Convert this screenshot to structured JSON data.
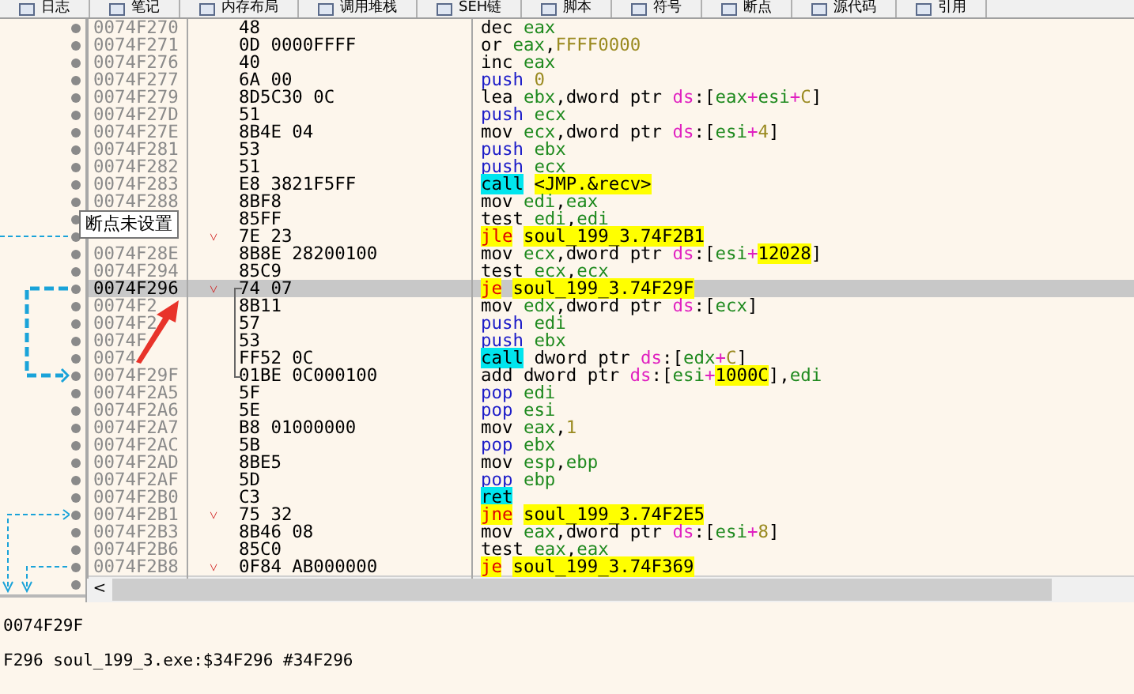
{
  "tabs": [
    {
      "label": "日志",
      "selected": false
    },
    {
      "label": "笔记",
      "selected": false
    },
    {
      "label": "内存布局",
      "selected": false
    },
    {
      "label": "调用堆栈",
      "selected": false
    },
    {
      "label": "SEH链",
      "selected": false
    },
    {
      "label": "脚本",
      "selected": false
    },
    {
      "label": "符号",
      "selected": false
    },
    {
      "label": "断点",
      "selected": false
    },
    {
      "label": "源代码",
      "selected": false
    },
    {
      "label": "引用",
      "selected": false
    }
  ],
  "rows": [
    {
      "address": "0074F270",
      "bytes": "48",
      "selected": false,
      "asm": [
        {
          "kind": "op",
          "text": "dec "
        },
        {
          "kind": "reg",
          "text": "eax"
        }
      ]
    },
    {
      "address": "0074F271",
      "bytes": "0D 0000FFFF",
      "selected": false,
      "asm": [
        {
          "kind": "op",
          "text": "or "
        },
        {
          "kind": "reg",
          "text": "eax"
        },
        {
          "kind": "txt",
          "text": ","
        },
        {
          "kind": "num",
          "text": "FFFF0000"
        }
      ]
    },
    {
      "address": "0074F276",
      "bytes": "40",
      "selected": false,
      "asm": [
        {
          "kind": "op",
          "text": "inc "
        },
        {
          "kind": "reg",
          "text": "eax"
        }
      ]
    },
    {
      "address": "0074F277",
      "bytes": "6A 00",
      "selected": false,
      "asm": [
        {
          "kind": "stack",
          "text": "push "
        },
        {
          "kind": "num",
          "text": "0"
        }
      ]
    },
    {
      "address": "0074F279",
      "bytes": "8D5C30 0C",
      "selected": false,
      "asm": [
        {
          "kind": "op",
          "text": "lea "
        },
        {
          "kind": "reg",
          "text": "ebx"
        },
        {
          "kind": "txt",
          "text": ",dword ptr "
        },
        {
          "kind": "seg",
          "text": "ds"
        },
        {
          "kind": "txt",
          "text": ":["
        },
        {
          "kind": "reg",
          "text": "eax"
        },
        {
          "kind": "seg",
          "text": "+"
        },
        {
          "kind": "reg",
          "text": "esi"
        },
        {
          "kind": "seg",
          "text": "+"
        },
        {
          "kind": "num",
          "text": "C"
        },
        {
          "kind": "txt",
          "text": "]"
        }
      ]
    },
    {
      "address": "0074F27D",
      "bytes": "51",
      "selected": false,
      "asm": [
        {
          "kind": "stack",
          "text": "push "
        },
        {
          "kind": "reg",
          "text": "ecx"
        }
      ]
    },
    {
      "address": "0074F27E",
      "bytes": "8B4E 04",
      "selected": false,
      "asm": [
        {
          "kind": "op",
          "text": "mov "
        },
        {
          "kind": "reg",
          "text": "ecx"
        },
        {
          "kind": "txt",
          "text": ",dword ptr "
        },
        {
          "kind": "seg",
          "text": "ds"
        },
        {
          "kind": "txt",
          "text": ":["
        },
        {
          "kind": "reg",
          "text": "esi"
        },
        {
          "kind": "seg",
          "text": "+"
        },
        {
          "kind": "num",
          "text": "4"
        },
        {
          "kind": "txt",
          "text": "]"
        }
      ]
    },
    {
      "address": "0074F281",
      "bytes": "53",
      "selected": false,
      "asm": [
        {
          "kind": "stack",
          "text": "push "
        },
        {
          "kind": "reg",
          "text": "ebx"
        }
      ]
    },
    {
      "address": "0074F282",
      "bytes": "51",
      "selected": false,
      "asm": [
        {
          "kind": "stack",
          "text": "push "
        },
        {
          "kind": "reg",
          "text": "ecx"
        }
      ]
    },
    {
      "address": "0074F283",
      "bytes": "E8 3821F5FF",
      "selected": false,
      "asm": [
        {
          "kind": "call",
          "text": "call"
        },
        {
          "kind": "label",
          "text": "<JMP.&recv>"
        }
      ]
    },
    {
      "address": "0074F288",
      "bytes": "8BF8",
      "selected": false,
      "asm": [
        {
          "kind": "op",
          "text": "mov "
        },
        {
          "kind": "reg",
          "text": "edi"
        },
        {
          "kind": "txt",
          "text": ","
        },
        {
          "kind": "reg",
          "text": "eax"
        }
      ]
    },
    {
      "bytes": "85FF",
      "selected": false,
      "asm": [
        {
          "kind": "op",
          "text": "test "
        },
        {
          "kind": "reg",
          "text": "edi"
        },
        {
          "kind": "txt",
          "text": ","
        },
        {
          "kind": "reg",
          "text": "edi"
        }
      ]
    },
    {
      "marker": "˅",
      "bytes": "7E 23",
      "selected": false,
      "asm": [
        {
          "kind": "jump",
          "text": "jle"
        },
        {
          "kind": "label",
          "text": "soul_199_3.74F2B1"
        }
      ]
    },
    {
      "address": "0074F28E",
      "bytes": "8B8E 28200100",
      "selected": false,
      "asm": [
        {
          "kind": "op",
          "text": "mov "
        },
        {
          "kind": "reg",
          "text": "ecx"
        },
        {
          "kind": "txt",
          "text": ",dword ptr "
        },
        {
          "kind": "seg",
          "text": "ds"
        },
        {
          "kind": "txt",
          "text": ":["
        },
        {
          "kind": "reg",
          "text": "esi"
        },
        {
          "kind": "seg",
          "text": "+"
        },
        {
          "kind": "hinum",
          "text": "12028"
        },
        {
          "kind": "txt",
          "text": "]"
        }
      ]
    },
    {
      "address": "0074F294",
      "bytes": "85C9",
      "selected": false,
      "asm": [
        {
          "kind": "op",
          "text": "test "
        },
        {
          "kind": "reg",
          "text": "ecx"
        },
        {
          "kind": "txt",
          "text": ","
        },
        {
          "kind": "reg",
          "text": "ecx"
        }
      ]
    },
    {
      "address": "0074F296",
      "marker": "˅",
      "bytes": "74 07",
      "selected": true,
      "asm": [
        {
          "kind": "jump",
          "text": "je"
        },
        {
          "kind": "label",
          "text": "soul_199_3.74F29F"
        }
      ]
    },
    {
      "address": "0074F2",
      "bytes": "8B11",
      "selected": false,
      "asm": [
        {
          "kind": "op",
          "text": "mov "
        },
        {
          "kind": "reg",
          "text": "edx"
        },
        {
          "kind": "txt",
          "text": ",dword ptr "
        },
        {
          "kind": "seg",
          "text": "ds"
        },
        {
          "kind": "txt",
          "text": ":["
        },
        {
          "kind": "reg",
          "text": "ecx"
        },
        {
          "kind": "txt",
          "text": "]"
        }
      ]
    },
    {
      "address": "0074F2",
      "bytes": "57",
      "selected": false,
      "asm": [
        {
          "kind": "stack",
          "text": "push "
        },
        {
          "kind": "reg",
          "text": "edi"
        }
      ]
    },
    {
      "address": "0074F",
      "bytes": "53",
      "selected": false,
      "asm": [
        {
          "kind": "stack",
          "text": "push "
        },
        {
          "kind": "reg",
          "text": "ebx"
        }
      ]
    },
    {
      "address": "0074",
      "bytes": "FF52 0C",
      "selected": false,
      "asm": [
        {
          "kind": "call",
          "text": "call"
        },
        {
          "kind": "txt",
          "text": " dword ptr "
        },
        {
          "kind": "seg",
          "text": "ds"
        },
        {
          "kind": "txt",
          "text": ":["
        },
        {
          "kind": "reg",
          "text": "edx"
        },
        {
          "kind": "seg",
          "text": "+"
        },
        {
          "kind": "num",
          "text": "C"
        },
        {
          "kind": "txt",
          "text": "]"
        }
      ]
    },
    {
      "address": "0074F29F",
      "bytes": "01BE 0C000100",
      "selected": false,
      "asm": [
        {
          "kind": "op",
          "text": "add dword ptr "
        },
        {
          "kind": "seg",
          "text": "ds"
        },
        {
          "kind": "txt",
          "text": ":["
        },
        {
          "kind": "reg",
          "text": "esi"
        },
        {
          "kind": "seg",
          "text": "+"
        },
        {
          "kind": "hinum",
          "text": "1000C"
        },
        {
          "kind": "txt",
          "text": "],"
        },
        {
          "kind": "reg",
          "text": "edi"
        }
      ]
    },
    {
      "address": "0074F2A5",
      "bytes": "5F",
      "selected": false,
      "asm": [
        {
          "kind": "stack",
          "text": "pop "
        },
        {
          "kind": "reg",
          "text": "edi"
        }
      ]
    },
    {
      "address": "0074F2A6",
      "bytes": "5E",
      "selected": false,
      "asm": [
        {
          "kind": "stack",
          "text": "pop "
        },
        {
          "kind": "reg",
          "text": "esi"
        }
      ]
    },
    {
      "address": "0074F2A7",
      "bytes": "B8 01000000",
      "selected": false,
      "asm": [
        {
          "kind": "op",
          "text": "mov "
        },
        {
          "kind": "reg",
          "text": "eax"
        },
        {
          "kind": "txt",
          "text": ","
        },
        {
          "kind": "num",
          "text": "1"
        }
      ]
    },
    {
      "address": "0074F2AC",
      "bytes": "5B",
      "selected": false,
      "asm": [
        {
          "kind": "stack",
          "text": "pop "
        },
        {
          "kind": "reg",
          "text": "ebx"
        }
      ]
    },
    {
      "address": "0074F2AD",
      "bytes": "8BE5",
      "selected": false,
      "asm": [
        {
          "kind": "op",
          "text": "mov "
        },
        {
          "kind": "reg",
          "text": "esp"
        },
        {
          "kind": "txt",
          "text": ","
        },
        {
          "kind": "reg",
          "text": "ebp"
        }
      ]
    },
    {
      "address": "0074F2AF",
      "bytes": "5D",
      "selected": false,
      "asm": [
        {
          "kind": "stack",
          "text": "pop "
        },
        {
          "kind": "reg",
          "text": "ebp"
        }
      ]
    },
    {
      "address": "0074F2B0",
      "bytes": "C3",
      "selected": false,
      "asm": [
        {
          "kind": "call",
          "text": "ret"
        }
      ]
    },
    {
      "address": "0074F2B1",
      "marker": "˅",
      "bytes": "75 32",
      "selected": false,
      "asm": [
        {
          "kind": "jump",
          "text": "jne"
        },
        {
          "kind": "label",
          "text": "soul_199_3.74F2E5"
        }
      ]
    },
    {
      "address": "0074F2B3",
      "bytes": "8B46 08",
      "selected": false,
      "asm": [
        {
          "kind": "op",
          "text": "mov "
        },
        {
          "kind": "reg",
          "text": "eax"
        },
        {
          "kind": "txt",
          "text": ",dword ptr "
        },
        {
          "kind": "seg",
          "text": "ds"
        },
        {
          "kind": "txt",
          "text": ":["
        },
        {
          "kind": "reg",
          "text": "esi"
        },
        {
          "kind": "seg",
          "text": "+"
        },
        {
          "kind": "num",
          "text": "8"
        },
        {
          "kind": "txt",
          "text": "]"
        }
      ]
    },
    {
      "address": "0074F2B6",
      "bytes": "85C0",
      "selected": false,
      "asm": [
        {
          "kind": "op",
          "text": "test "
        },
        {
          "kind": "reg",
          "text": "eax"
        },
        {
          "kind": "txt",
          "text": ","
        },
        {
          "kind": "reg",
          "text": "eax"
        }
      ]
    },
    {
      "address": "0074F2B8",
      "marker": "˅",
      "bytes": "0F84 AB000000",
      "selected": false,
      "asm": [
        {
          "kind": "jump",
          "text": "je"
        },
        {
          "kind": "label",
          "text": "soul_199_3.74F369"
        }
      ]
    }
  ],
  "tooltip": "断点未设置",
  "scroll_left": "<",
  "info_lines": [
    "0074F29F",
    "F296 soul_199_3.exe:$34F296 #34F296"
  ]
}
